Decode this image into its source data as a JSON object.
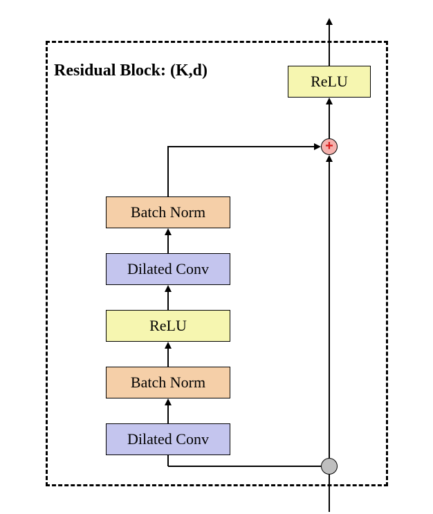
{
  "title": "Residual Block:  (K,d)",
  "blocks": {
    "dconv1": "Dilated Conv",
    "bn1": "Batch Norm",
    "relu1": "ReLU",
    "dconv2": "Dilated Conv",
    "bn2": "Batch Norm",
    "relu2": "ReLU"
  },
  "symbols": {
    "plus": "+"
  },
  "colors": {
    "dilated": "#c4c5ee",
    "bn": "#f5cfa8",
    "relu": "#f6f6b0",
    "split": "#bfbfbf",
    "add": "#f5b1ad"
  }
}
